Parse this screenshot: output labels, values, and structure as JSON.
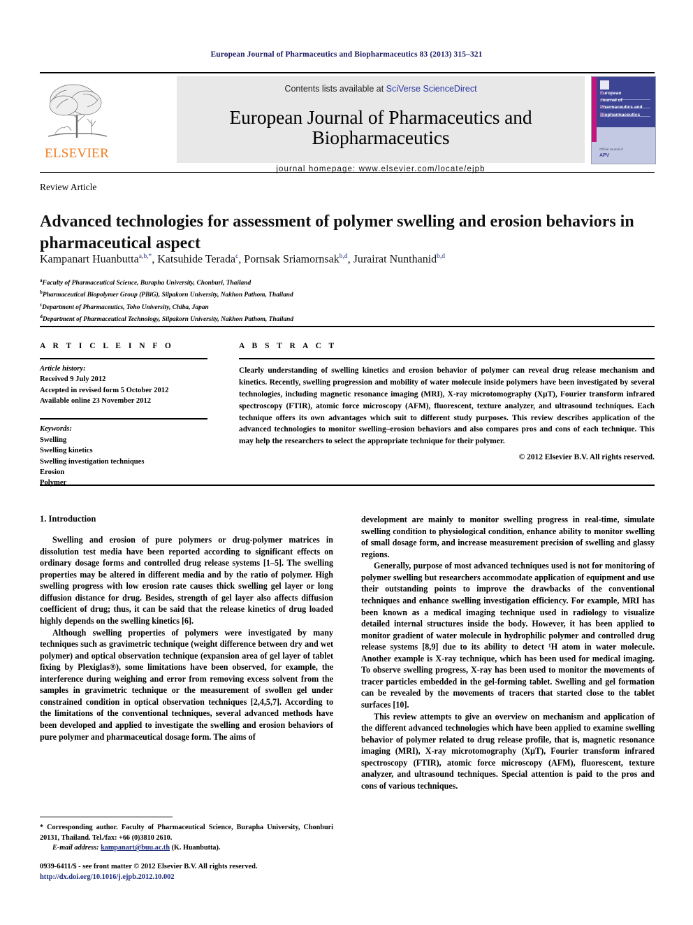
{
  "running_head": "European Journal of Pharmaceutics and Biopharmaceutics 83 (2013) 315–321",
  "masthead": {
    "contents_prefix": "Contents lists available at ",
    "contents_link": "SciVerse ScienceDirect",
    "journal_title": "European Journal of Pharmaceutics and Biopharmaceutics",
    "homepage": "journal homepage: www.elsevier.com/locate/ejpb",
    "publisher_wordmark": "ELSEVIER",
    "publisher_logo_icon": "elsevier-tree-logo",
    "cover": {
      "line1_cap": "E",
      "line1_rest": "uropean",
      "line2_cap": "J",
      "line2_rest": "ournal of",
      "line3_cap": "P",
      "line3_rest": "harmaceutics and",
      "line4_cap": "B",
      "line4_rest": "iopharmaceutics",
      "footer_label": "Official Journal of",
      "footer_org": "APV"
    }
  },
  "article": {
    "type": "Review Article",
    "title": "Advanced technologies for assessment of polymer swelling and erosion behaviors in pharmaceutical aspect",
    "authors": [
      {
        "name": "Kampanart Huanbutta",
        "marks": "a,b,*"
      },
      {
        "name": "Katsuhide Terada",
        "marks": "c"
      },
      {
        "name": "Pornsak Sriamornsak",
        "marks": "b,d"
      },
      {
        "name": "Jurairat Nunthanid",
        "marks": "b,d"
      }
    ],
    "affiliations": [
      {
        "mark": "a",
        "text": "Faculty of Pharmaceutical Science, Burapha University, Chonburi, Thailand"
      },
      {
        "mark": "b",
        "text": "Pharmaceutical Biopolymer Group (PBiG), Silpakorn University, Nakhon Pathom, Thailand"
      },
      {
        "mark": "c",
        "text": "Department of Pharmaceutics, Toho University, Chiba, Japan"
      },
      {
        "mark": "d",
        "text": "Department of Pharmaceutical Technology, Silpakorn University, Nakhon Pathom, Thailand"
      }
    ]
  },
  "info": {
    "heading": "A R T I C L E   I N F O",
    "history_label": "Article history:",
    "history": [
      "Received 9 July 2012",
      "Accepted in revised form 5 October 2012",
      "Available online 23 November 2012"
    ],
    "keywords_label": "Keywords:",
    "keywords": [
      "Swelling",
      "Swelling kinetics",
      "Swelling investigation techniques",
      "Erosion",
      "Polymer"
    ]
  },
  "abstract": {
    "heading": "A B S T R A C T",
    "text": "Clearly understanding of swelling kinetics and erosion behavior of polymer can reveal drug release mechanism and kinetics. Recently, swelling progression and mobility of water molecule inside polymers have been investigated by several technologies, including magnetic resonance imaging (MRI), X-ray microtomography (XμT), Fourier transform infrared spectroscopy (FTIR), atomic force microscopy (AFM), fluorescent, texture analyzer, and ultrasound techniques. Each technique offers its own advantages which suit to different study purposes. This review describes application of the advanced technologies to monitor swelling–erosion behaviors and also compares pros and cons of each technique. This may help the researchers to select the appropriate technique for their polymer.",
    "copyright": "© 2012 Elsevier B.V. All rights reserved."
  },
  "body": {
    "section1_heading": "1. Introduction",
    "left_paragraphs": [
      "Swelling and erosion of pure polymers or drug-polymer matrices in dissolution test media have been reported according to significant effects on ordinary dosage forms and controlled drug release systems [1–5]. The swelling properties may be altered in different media and by the ratio of polymer. High swelling progress with low erosion rate causes thick swelling gel layer or long diffusion distance for drug. Besides, strength of gel layer also affects diffusion coefficient of drug; thus, it can be said that the release kinetics of drug loaded highly depends on the swelling kinetics [6].",
      "Although swelling properties of polymers were investigated by many techniques such as gravimetric technique (weight difference between dry and wet polymer) and optical observation technique (expansion area of gel layer of tablet fixing by Plexiglas®), some limitations have been observed, for example, the interference during weighing and error from removing excess solvent from the samples in gravimetric technique or the measurement of swollen gel under constrained condition in optical observation techniques [2,4,5,7]. According to the limitations of the conventional techniques, several advanced methods have been developed and applied to investigate the swelling and erosion behaviors of pure polymer and pharmaceutical dosage form. The aims of"
    ],
    "right_paragraphs": [
      "development are mainly to monitor swelling progress in real-time, simulate swelling condition to physiological condition, enhance ability to monitor swelling of small dosage form, and increase measurement precision of swelling and glassy regions.",
      "Generally, purpose of most advanced techniques used is not for monitoring of polymer swelling but researchers accommodate application of equipment and use their outstanding points to improve the drawbacks of the conventional techniques and enhance swelling investigation efficiency. For example, MRI has been known as a medical imaging technique used in radiology to visualize detailed internal structures inside the body. However, it has been applied to monitor gradient of water molecule in hydrophilic polymer and controlled drug release systems [8,9] due to its ability to detect ¹H atom in water molecule. Another example is X-ray technique, which has been used for medical imaging. To observe swelling progress, X-ray has been used to monitor the movements of tracer particles embedded in the gel-forming tablet. Swelling and gel formation can be revealed by the movements of tracers that started close to the tablet surfaces [10].",
      "This review attempts to give an overview on mechanism and application of the different advanced technologies which have been applied to examine swelling behavior of polymer related to drug release profile, that is, magnetic resonance imaging (MRI), X-ray microtomography (XμT), Fourier transform infrared spectroscopy (FTIR), atomic force microscopy (AFM), fluorescent, texture analyzer, and ultrasound techniques. Special attention is paid to the pros and cons of various techniques."
    ]
  },
  "footnotes": {
    "corresponding": "* Corresponding author. Faculty of Pharmaceutical Science, Burapha University, Chonburi 20131, Thailand. Tel./fax: +66 (0)3810 2610.",
    "email_label": "E-mail address:",
    "email": "kampanart@buu.ac.th",
    "email_suffix": " (K. Huanbutta)."
  },
  "frontmatter": {
    "issn_line": "0939-6411/$ - see front matter © 2012 Elsevier B.V. All rights reserved.",
    "doi": "http://dx.doi.org/10.1016/j.ejpb.2012.10.002"
  },
  "colors": {
    "link_blue": "#1b2b7a",
    "sciencedirect_blue": "#2b39a8",
    "elsevier_orange": "#F07C1E",
    "cover_navy": "#3d4494",
    "cover_magenta": "#c2157e"
  }
}
